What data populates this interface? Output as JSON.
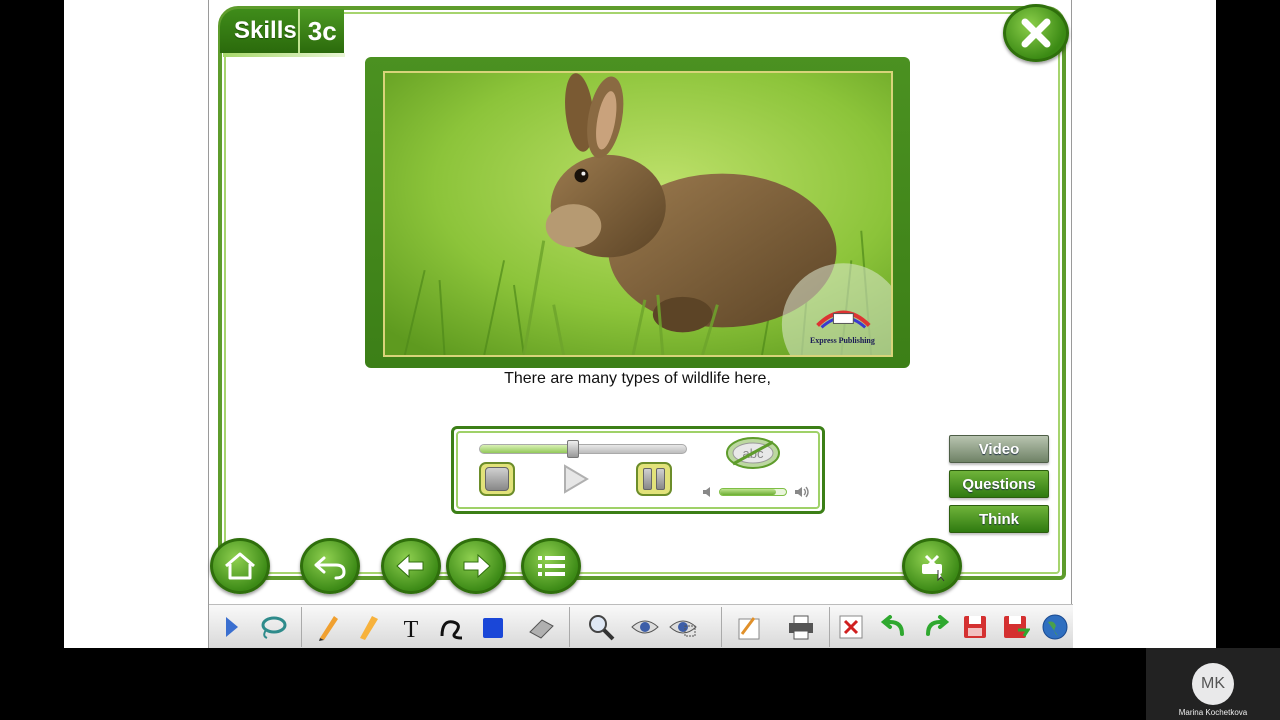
{
  "header": {
    "section_label": "Skills",
    "unit_label": "3c"
  },
  "photo": {
    "watermark": "Express Publishing"
  },
  "caption": "There are many types of wildlife here,",
  "player": {
    "progress_fraction": 0.45,
    "volume_fraction": 0.85,
    "subtitle_toggle": "abc"
  },
  "side_tabs": {
    "video": "Video",
    "questions": "Questions",
    "think": "Think"
  },
  "participant": {
    "initials": "MK",
    "name": "Marina Kochetkova"
  },
  "colors": {
    "primary_green": "#3c7f17",
    "light_green": "#a6d46e",
    "tab_inactive": "#6f8266"
  }
}
